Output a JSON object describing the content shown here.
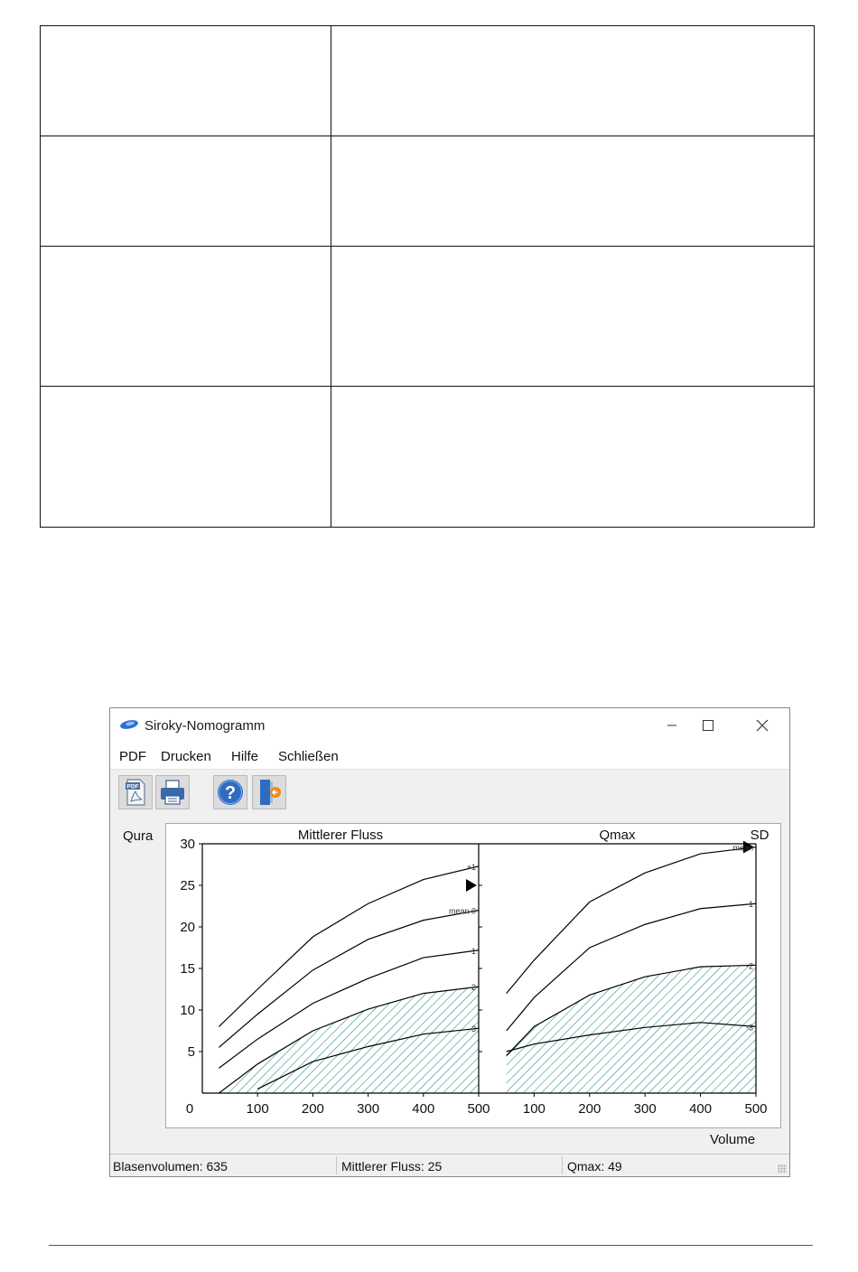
{
  "window": {
    "title": "Siroky-Nomogramm",
    "controls": {
      "minimize_icon": "minimize-icon",
      "maximize_icon": "maximize-icon",
      "close_icon": "close-icon"
    }
  },
  "menu": [
    "PDF",
    "Drucken",
    "Hilfe",
    "Schließen"
  ],
  "toolbar": [
    {
      "icon": "pdf-icon"
    },
    {
      "icon": "printer-icon"
    },
    {
      "icon": "help-icon"
    },
    {
      "icon": "exit-icon"
    }
  ],
  "labels": {
    "y_axis": "Qura",
    "x_axis": "Volume"
  },
  "status": {
    "bladder_volume": "Blasenvolumen: 635",
    "mean_flow": "Mittlerer Fluss: 25",
    "qmax": "Qmax: 49"
  },
  "colors": {
    "hatch": "#1a8a7e",
    "axis": "#000000"
  },
  "chart_data": [
    {
      "type": "line",
      "title": "Mittlerer Fluss",
      "xlim": [
        0,
        500
      ],
      "ylim": [
        0,
        30
      ],
      "xticks": [
        "100",
        "200",
        "300",
        "400",
        "500"
      ],
      "yticks": [
        "0",
        "5",
        "10",
        "15",
        "20",
        "25",
        "30"
      ],
      "x": [
        30,
        100,
        200,
        300,
        400,
        500
      ],
      "series": [
        {
          "name": "+1",
          "values": [
            8,
            12.5,
            18.8,
            22.8,
            25.7,
            27.3
          ]
        },
        {
          "name": "mean 0",
          "values": [
            5.5,
            9.5,
            14.8,
            18.5,
            20.8,
            22
          ]
        },
        {
          "name": "-1",
          "values": [
            3,
            6.5,
            10.8,
            13.8,
            16.3,
            17.2
          ]
        },
        {
          "name": "-2",
          "values": [
            0,
            3.5,
            7.5,
            10.1,
            12,
            12.8
          ]
        },
        {
          "name": "-3",
          "values": [
            null,
            0.5,
            3.8,
            5.6,
            7.1,
            7.8
          ]
        }
      ],
      "hatched_region": "below -2",
      "marker": {
        "label": "mean 0",
        "y": 25
      }
    },
    {
      "type": "line",
      "title": "Qmax",
      "xlim": [
        0,
        500
      ],
      "ylim": [
        0,
        30
      ],
      "xticks": [
        "100",
        "200",
        "300",
        "400",
        "500"
      ],
      "right_label": "SD",
      "x": [
        50,
        100,
        200,
        300,
        400,
        500
      ],
      "series": [
        {
          "name": "mean",
          "values": [
            12,
            16,
            23,
            26.5,
            28.8,
            29.6
          ]
        },
        {
          "name": "-1",
          "values": [
            7.5,
            11.5,
            17.5,
            20.3,
            22.2,
            22.8
          ]
        },
        {
          "name": "-2",
          "values": [
            4.5,
            8,
            11.8,
            14,
            15.2,
            15.4
          ]
        },
        {
          "name": "-3",
          "values": [
            5,
            5.9,
            7,
            7.9,
            8.5,
            8.0
          ]
        }
      ],
      "hatched_region": "below -2",
      "marker": {
        "label": "mean",
        "y": 29.6
      }
    }
  ]
}
